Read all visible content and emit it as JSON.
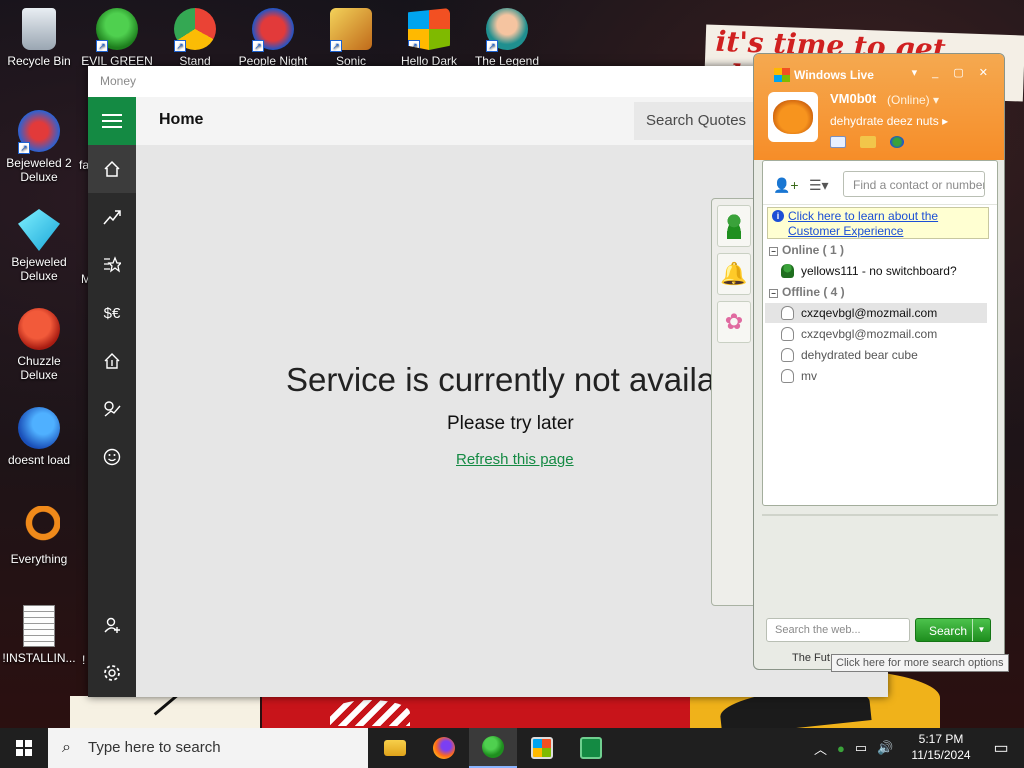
{
  "wallpaper": {
    "text": "it's time to get shit"
  },
  "desktop_icons": [
    {
      "label": "Recycle Bin"
    },
    {
      "label": "Bejeweled 2 Deluxe"
    },
    {
      "label": "Bejeweled Deluxe"
    },
    {
      "label": "Chuzzle Deluxe"
    },
    {
      "label": "doesnt load"
    },
    {
      "label": "Everything"
    },
    {
      "label": "!INSTALLIN..."
    }
  ],
  "desktop_top_icons": [
    {
      "label": "EVIL GREEN"
    },
    {
      "label": "Stand"
    },
    {
      "label": "People Night"
    },
    {
      "label": "Sonic"
    },
    {
      "label": "Hello Dark"
    },
    {
      "label": "The Legend"
    }
  ],
  "desktop_partial": {
    "fa": "fa",
    "m": "M",
    "excl": "!"
  },
  "money": {
    "window_title": "Money",
    "header_title": "Home",
    "search_placeholder": "Search Quotes",
    "nav_currency_label": "$€",
    "error_title": "Service is currently not available",
    "error_sub": "Please try later",
    "refresh_link": "Refresh this page"
  },
  "messenger": {
    "app_title": "Windows Live",
    "username": "VM0b0t",
    "status": "(Online) ▾",
    "personal_message": "dehydrate deez nuts ▸",
    "find_placeholder": "Find a contact or number...",
    "banner_text": "Click here to learn about the Customer Experience",
    "groups": {
      "online": "Online ( 1 )",
      "offline": "Offline ( 4 )"
    },
    "online_contacts": [
      "yellows111 - no switchboard?"
    ],
    "offline_contacts": [
      "cxzqevbgl@mozmail.com",
      "cxzqevbgl@mozmail.com",
      "dehydrated bear cube",
      "mv"
    ],
    "web_search_placeholder": "Search the web...",
    "search_button": "Search",
    "footer_text": "The Fut",
    "tooltip": "Click here for more search options"
  },
  "taskbar": {
    "search_placeholder": "Type here to search",
    "time": "5:17 PM",
    "date": "11/15/2024"
  },
  "colors": {
    "money_accent": "#148a43",
    "messenger_header": "#f68d28",
    "taskbar": "#1f1f1f"
  }
}
